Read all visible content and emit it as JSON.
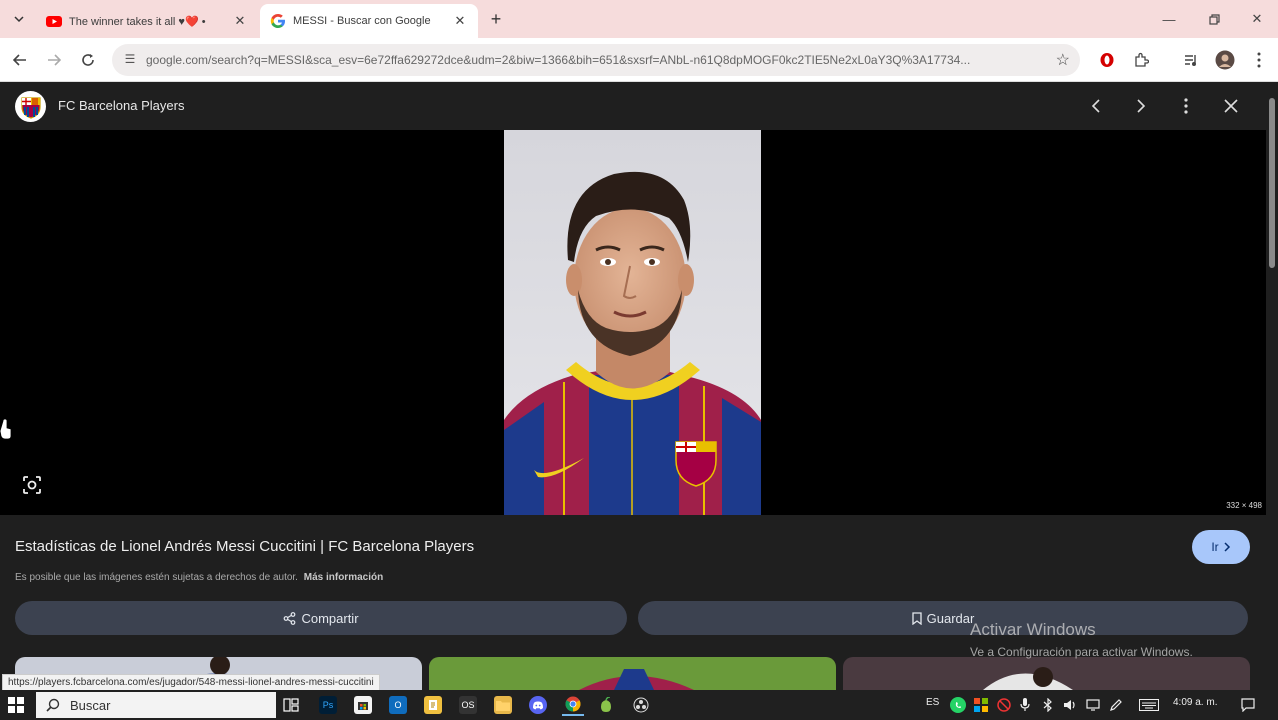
{
  "browser": {
    "tabs": [
      {
        "title": "The winner takes it all ♥❤️ • ",
        "favicon": "youtube-icon",
        "active": false
      },
      {
        "title": "MESSI - Buscar con Google",
        "favicon": "google-icon",
        "active": true
      }
    ],
    "url": "google.com/search?q=MESSI&sca_esv=6e72ffa629272dce&udm=2&biw=1366&bih=651&sxsrf=ANbL-n61Q8dpMOGF0kc2TIE5Ne2xL0aY3Q%3A17734..."
  },
  "viewer": {
    "source_name": "FC Barcelona Players",
    "image_dims": "332 × 498",
    "result_title": "Estadísticas de Lionel Andrés Messi Cuccitini | FC Barcelona Players",
    "go_label": "Ir",
    "copyright": "Es posible que las imágenes estén sujetas a derechos de autor.",
    "more_info": "Más información",
    "share_label": "Compartir",
    "save_label": "Guardar"
  },
  "watermark": {
    "line1": "Activar Windows",
    "line2": "Ve a Configuración para activar Windows."
  },
  "status_url": "https://players.fcbarcelona.com/es/jugador/548-messi-lionel-andres-messi-cuccitini",
  "taskbar": {
    "search_placeholder": "Buscar",
    "language": "ES",
    "time": "4:09 a. m."
  },
  "colors": {
    "tab_strip": "#f6dcdc",
    "viewer_bg": "#1f1f1f",
    "accent_button": "#a8c7fa",
    "pill_button": "#3c4250"
  }
}
